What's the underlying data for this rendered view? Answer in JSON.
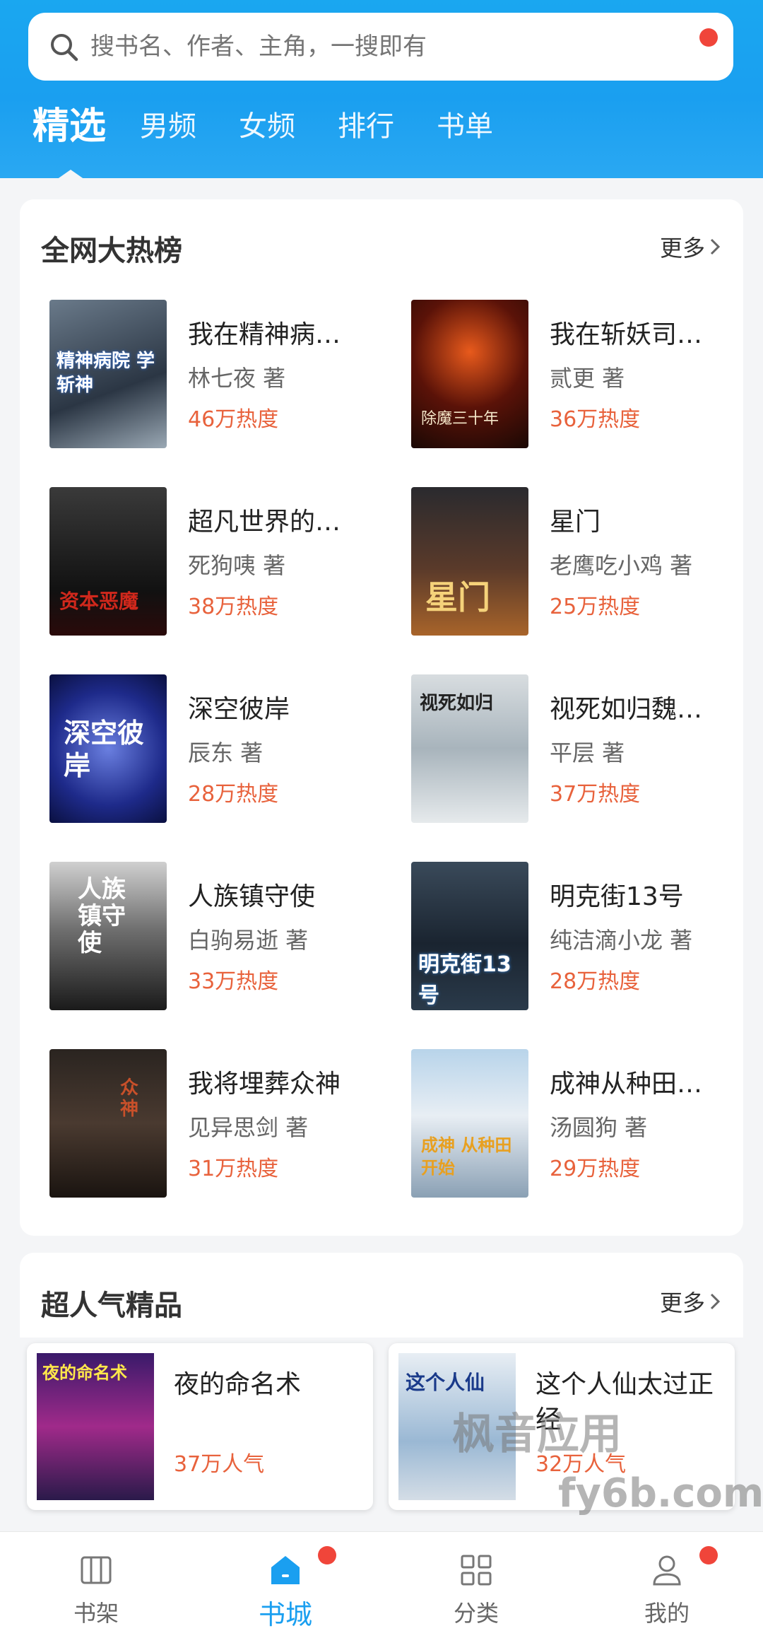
{
  "search": {
    "placeholder": "搜书名、作者、主角，一搜即有"
  },
  "tabs": [
    {
      "label": "精选"
    },
    {
      "label": "男频"
    },
    {
      "label": "女频"
    },
    {
      "label": "排行"
    },
    {
      "label": "书单"
    }
  ],
  "hot": {
    "title": "全网大热榜",
    "more": "更多",
    "books": [
      {
        "title": "我在精神病…",
        "author": "林七夜 著",
        "heat": "46万热度",
        "cover_text": "精神病院 学斩神"
      },
      {
        "title": "我在斩妖司…",
        "author": "贰更 著",
        "heat": "36万热度",
        "cover_text": "除魔三十年"
      },
      {
        "title": "超凡世界的…",
        "author": "死狗咦 著",
        "heat": "38万热度",
        "cover_text": "资本恶魔"
      },
      {
        "title": "星门",
        "author": "老鹰吃小鸡 著",
        "heat": "25万热度",
        "cover_text": "星门"
      },
      {
        "title": "深空彼岸",
        "author": "辰东 著",
        "heat": "28万热度",
        "cover_text": "深空彼岸"
      },
      {
        "title": "视死如归魏…",
        "author": "平层 著",
        "heat": "37万热度",
        "cover_text": "视死如归"
      },
      {
        "title": "人族镇守使",
        "author": "白驹易逝 著",
        "heat": "33万热度",
        "cover_text": "人族镇守使"
      },
      {
        "title": "明克街13号",
        "author": "纯洁滴小龙 著",
        "heat": "28万热度",
        "cover_text": "明克街13号"
      },
      {
        "title": "我将埋葬众神",
        "author": "见异思剑 著",
        "heat": "31万热度",
        "cover_text": "众神"
      },
      {
        "title": "成神从种田…",
        "author": "汤圆狗 著",
        "heat": "29万热度",
        "cover_text": "成神 从种田开始"
      }
    ]
  },
  "popular": {
    "title": "超人气精品",
    "more": "更多",
    "books": [
      {
        "title": "夜的命名术",
        "pop": "37万人气",
        "cover_text": "夜的命名术"
      },
      {
        "title": "这个人仙太过正经",
        "pop": "32万人气",
        "cover_text": "这个人仙"
      }
    ]
  },
  "nav": [
    {
      "label": "书架"
    },
    {
      "label": "书城"
    },
    {
      "label": "分类"
    },
    {
      "label": "我的"
    }
  ],
  "watermark": {
    "line1": "枫音应用",
    "line2": "fy6b.com"
  },
  "colors": {
    "accent": "#1a9ff0",
    "heat": "#e8623c",
    "badge": "#f0453a"
  }
}
